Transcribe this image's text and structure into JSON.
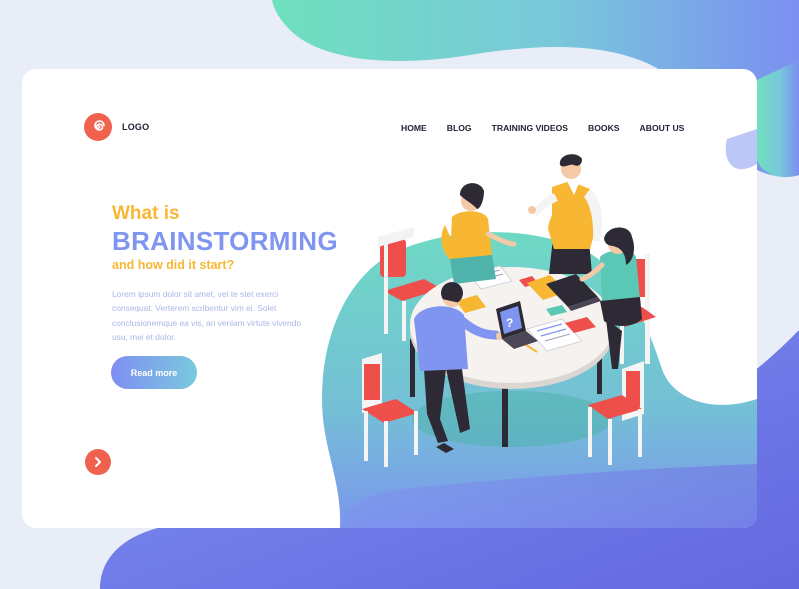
{
  "header": {
    "logo_label": "LOGO",
    "nav": [
      {
        "label": "HOME"
      },
      {
        "label": "BLOG"
      },
      {
        "label": "TRAINING VIDEOS"
      },
      {
        "label": "BOOKS"
      },
      {
        "label": "ABOUT US"
      }
    ]
  },
  "hero": {
    "line1": "What is",
    "line2": "BRAINSTORMING",
    "line3": "and how did it start?",
    "body": "Lorem ipsum dolor sit amet, vel te stet exerci consequat. Verterem scribentur vim ei. Solet conclusionemque ea vis, an veniam virtute vivendo usu, mei et dolor.",
    "cta_label": "Read more"
  },
  "illustration": {
    "laptop_symbol": "?"
  },
  "icons": {
    "logo": "spiral-logo-icon",
    "next": "chevron-right-icon"
  },
  "colors": {
    "accent_orange": "#f0624d",
    "heading_yellow": "#f7b733",
    "heading_blue": "#7f95f0",
    "teal": "#5bc8b5",
    "violet": "#6f7ee8"
  }
}
